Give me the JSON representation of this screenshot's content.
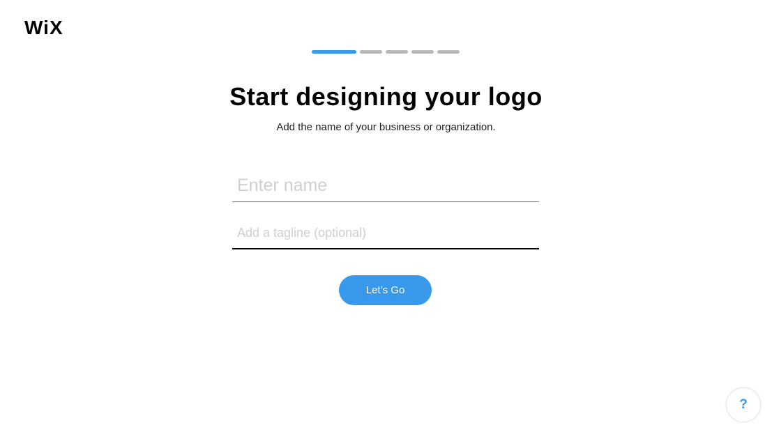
{
  "brand": {
    "logo_text": "WiX"
  },
  "progress": {
    "total_steps": 5,
    "current_step": 1,
    "accent_color": "#3899ec",
    "inactive_color": "#b9b9b9"
  },
  "main": {
    "title": "Start designing your logo",
    "subtitle": "Add the name of your business or organization.",
    "name_input": {
      "value": "",
      "placeholder": "Enter name"
    },
    "tagline_input": {
      "value": "",
      "placeholder": "Add a tagline (optional)"
    },
    "submit_label": "Let’s Go"
  },
  "help": {
    "label": "?",
    "icon": "question-icon"
  }
}
